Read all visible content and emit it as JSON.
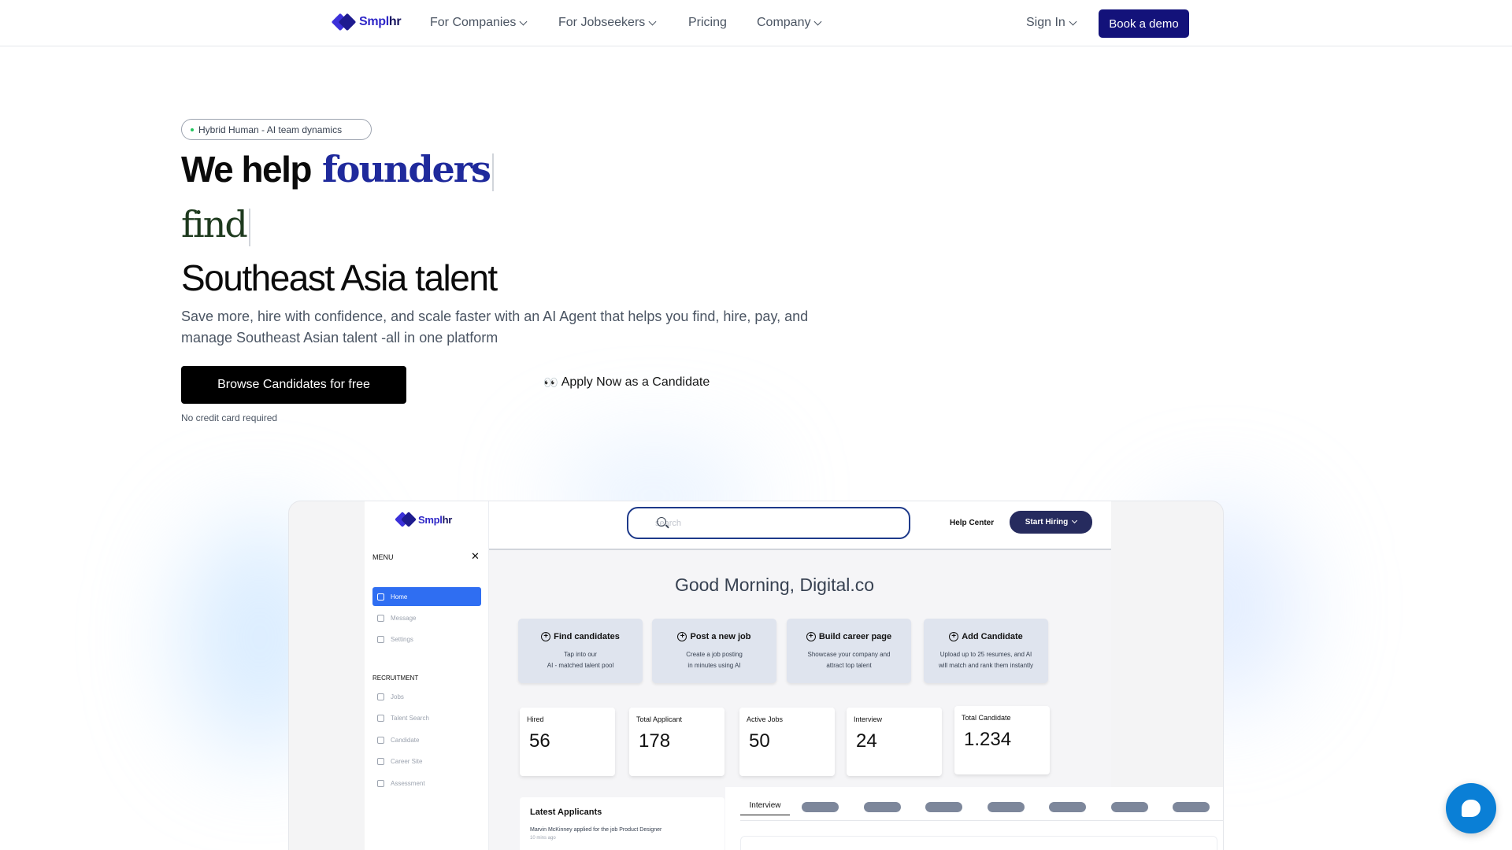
{
  "brand": {
    "name_part1": "Smpl",
    "name_part2": "hr"
  },
  "nav": {
    "items": [
      {
        "label": "For Companies",
        "has_dropdown": true
      },
      {
        "label": "For Jobseekers",
        "has_dropdown": true
      },
      {
        "label": "Pricing",
        "has_dropdown": false
      },
      {
        "label": "Company",
        "has_dropdown": true
      }
    ],
    "sign_in": "Sign In",
    "demo": "Book a demo"
  },
  "hero": {
    "badge": "Hybrid Human - AI team dynamics",
    "line1_prefix": "We help",
    "line1_rotating": "founders",
    "line2_rotating": "find",
    "line3": "Southeast Asia talent",
    "subtext": "Save more, hire with confidence, and scale faster with an AI Agent that helps you find, hire, pay, and manage Southeast Asian talent -all in one platform",
    "primary_cta": "Browse Candidates for free",
    "secondary_cta": "Apply Now as a Candidate",
    "secondary_icon": "eyes-icon",
    "note": "No credit card required"
  },
  "dashboard": {
    "menu_label": "MENU",
    "sidebar": [
      {
        "label": "Home",
        "active": true
      },
      {
        "label": "Message",
        "active": false
      },
      {
        "label": "Settings",
        "active": false
      }
    ],
    "recruitment_label": "RECRUITMENT",
    "recruitment": [
      {
        "label": "Jobs"
      },
      {
        "label": "Talent Search"
      },
      {
        "label": "Candidate"
      },
      {
        "label": "Career Site"
      },
      {
        "label": "Assessment"
      }
    ],
    "search_placeholder": "search",
    "help": "Help Center",
    "start_hiring": "Start Hiring",
    "greeting": "Good Morning, Digital.co",
    "actions": [
      {
        "title": "Find candidates",
        "desc1": "Tap into our",
        "desc2": "AI - matched talent pool"
      },
      {
        "title": "Post a new job",
        "desc1": "Create a job posting",
        "desc2": "in minutes using AI"
      },
      {
        "title": "Build career page",
        "desc1": "Showcase your company and",
        "desc2": "attract top talent"
      },
      {
        "title": "Add Candidate",
        "desc1": "Upload up to 25 resumes, and AI",
        "desc2": "will match and rank them instantly"
      }
    ],
    "stats": [
      {
        "label": "Hired",
        "value": "56"
      },
      {
        "label": "Total Applicant",
        "value": "178"
      },
      {
        "label": "Active Jobs",
        "value": "50"
      },
      {
        "label": "Interview",
        "value": "24"
      },
      {
        "label": "Total Candidate",
        "value": "1.234"
      }
    ],
    "latest": {
      "title": "Latest Applicants",
      "line": "Marvin McKinney applied for the job Product Designer",
      "time": "10 mins ago"
    },
    "tab_active": "Interview"
  },
  "colors": {
    "brand_navy": "#13127a",
    "brand_blue": "#2f27c7",
    "serif_blue": "#1f2a9c",
    "serif_green": "#1e3a1e",
    "chat_blue": "#0a7fd6"
  }
}
